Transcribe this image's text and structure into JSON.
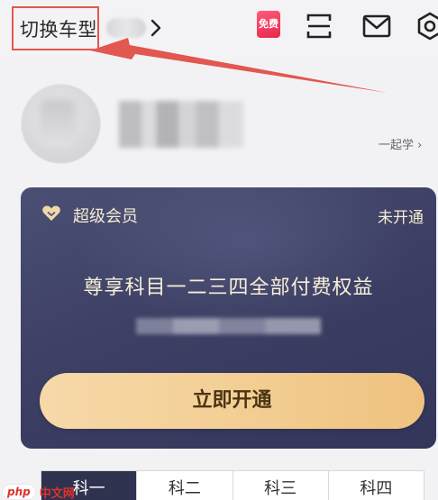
{
  "header": {
    "switch_label": "切换车型",
    "free_badge": "免费",
    "icons": [
      "chevron-right-icon",
      "free-badge-icon",
      "scan-icon",
      "mail-icon",
      "settings-icon"
    ]
  },
  "profile": {
    "study_link": "一起学 ›"
  },
  "vip": {
    "title": "超级会员",
    "status": "未开通",
    "benefit": "尊享科目一二三四全部付费权益",
    "button_label": "立即开通",
    "colors": {
      "card": "#3d4064",
      "button": "#f3cf95",
      "text": "#f6ecd3"
    }
  },
  "tabs": [
    {
      "label": "科一"
    },
    {
      "label": "科二"
    },
    {
      "label": "科三"
    },
    {
      "label": "科四"
    }
  ],
  "watermark": {
    "logo": "php",
    "text": "中文网"
  },
  "annotation": {
    "highlight_color": "#e2574f"
  }
}
